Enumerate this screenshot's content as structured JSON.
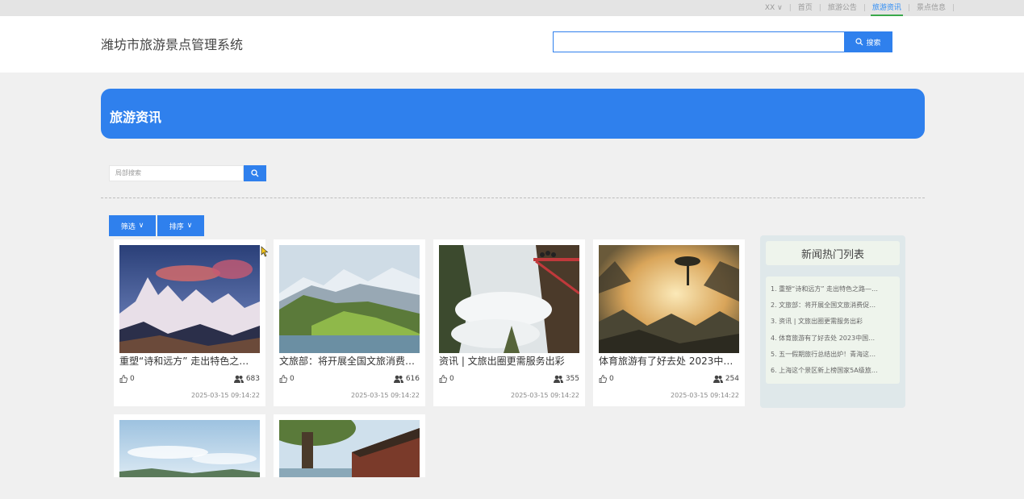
{
  "topnav": {
    "user": "XX",
    "items": [
      "首页",
      "旅游公告",
      "旅游资讯",
      "景点信息"
    ],
    "active_index": 2
  },
  "header": {
    "site_title": "潍坊市旅游景点管理系统",
    "search_value": "",
    "search_button": "搜索"
  },
  "banner": {
    "title": "旅游资讯"
  },
  "filter": {
    "local_search_placeholder": "局部搜索",
    "filter_button": "筛选",
    "sort_button": "排序"
  },
  "articles": [
    {
      "title": "重塑“诗和远方” 走出特色之…",
      "likes": "0",
      "views": "683",
      "date": "2025-03-15 09:14:22"
    },
    {
      "title": "文旅部：将开展全国文旅消费…",
      "likes": "0",
      "views": "616",
      "date": "2025-03-15 09:14:22"
    },
    {
      "title": "资讯 | 文旅出圈更需服务出彩",
      "likes": "0",
      "views": "355",
      "date": "2025-03-15 09:14:22"
    },
    {
      "title": "体育旅游有了好去处 2023中…",
      "likes": "0",
      "views": "254",
      "date": "2025-03-15 09:14:22"
    }
  ],
  "hot": {
    "title": "新闻热门列表",
    "items": [
      "1. 重塑“诗和远方” 走出特色之路—…",
      "2. 文旅部：将开展全国文旅消费促…",
      "3. 资讯 | 文旅出圈更需服务出彩",
      "4. 体育旅游有了好去处 2023中国…",
      "5. 五一假期旅行总结出炉！青海这…",
      "6. 上海这个景区新上榜国家5A级旅…"
    ]
  },
  "colors": {
    "primary": "#2f80ed",
    "active_underline": "#3aa84a",
    "page_bg": "#f0f0f0"
  }
}
